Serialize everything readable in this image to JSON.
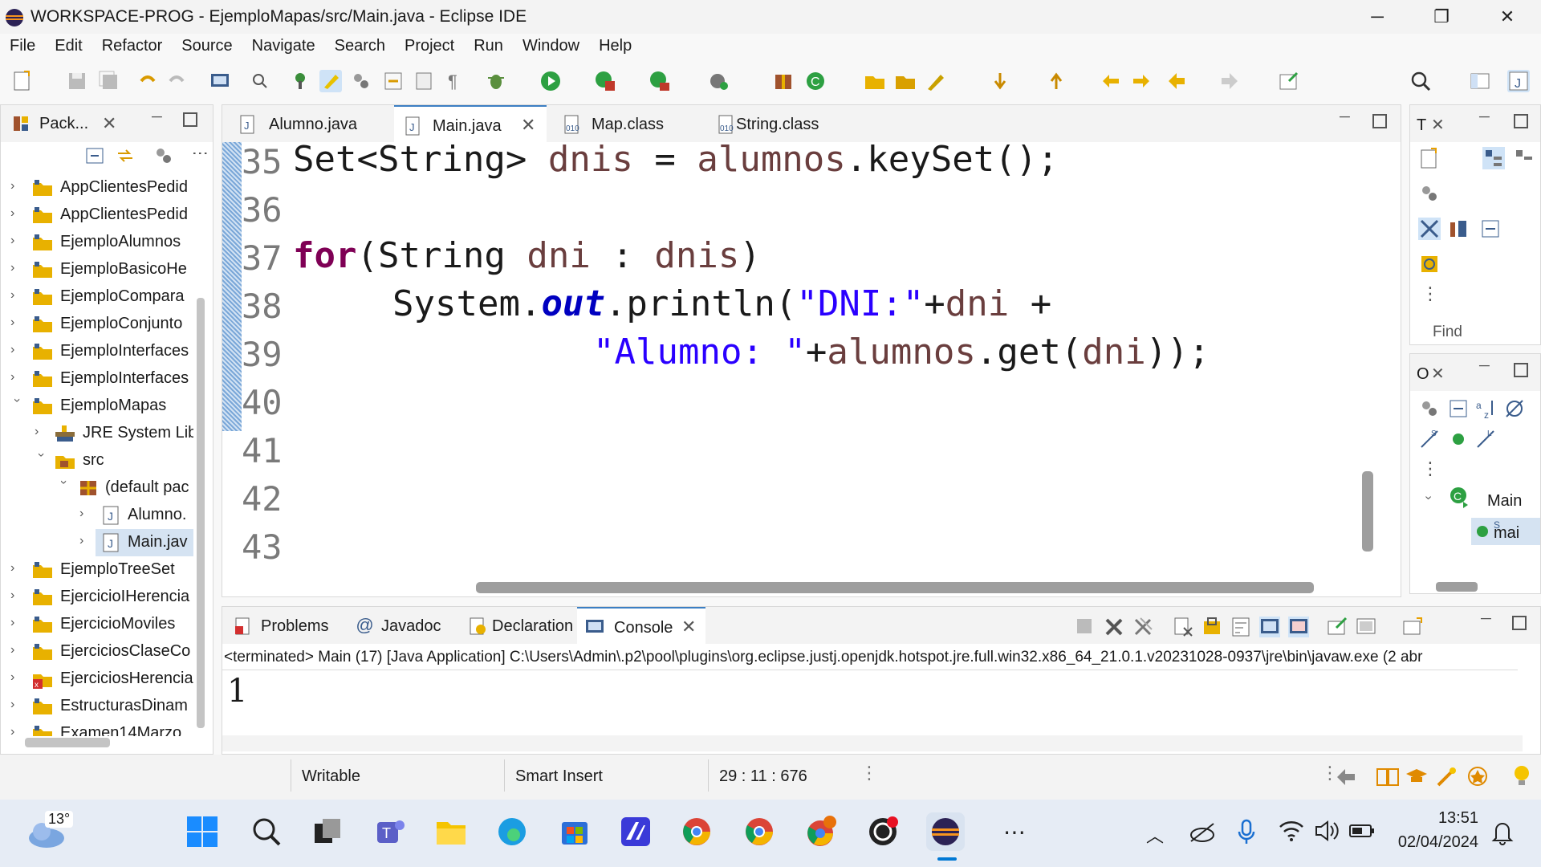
{
  "window": {
    "title": "WORKSPACE-PROG - EjemploMapas/src/Main.java - Eclipse IDE",
    "minimize_icon": "─",
    "restore_icon": "❐",
    "close_icon": "✕"
  },
  "menu": [
    "File",
    "Edit",
    "Refactor",
    "Source",
    "Navigate",
    "Search",
    "Project",
    "Run",
    "Window",
    "Help"
  ],
  "package_explorer": {
    "tab_label": "Pack...",
    "items": [
      {
        "label": "AppClientesPedid",
        "type": "project"
      },
      {
        "label": "AppClientesPedid",
        "type": "project"
      },
      {
        "label": "EjemploAlumnos",
        "type": "project"
      },
      {
        "label": "EjemploBasicoHe",
        "type": "project"
      },
      {
        "label": "EjemploCompara",
        "type": "project"
      },
      {
        "label": "EjemploConjunto",
        "type": "project"
      },
      {
        "label": "EjemploInterfaces",
        "type": "project"
      },
      {
        "label": "EjemploInterfaces",
        "type": "project"
      },
      {
        "label": "EjemploMapas",
        "type": "project-open"
      },
      {
        "label": "JRE System Lib",
        "type": "library"
      },
      {
        "label": "src",
        "type": "source-folder"
      },
      {
        "label": "(default pac",
        "type": "package"
      },
      {
        "label": "Alumno.",
        "type": "java-file"
      },
      {
        "label": "Main.jav",
        "type": "java-file-selected"
      },
      {
        "label": "EjemploTreeSet",
        "type": "project"
      },
      {
        "label": "EjercicioIHerencia",
        "type": "project"
      },
      {
        "label": "EjercicioMoviles",
        "type": "project"
      },
      {
        "label": "EjerciciosClaseCo",
        "type": "project"
      },
      {
        "label": "EjerciciosHerencia",
        "type": "project-error"
      },
      {
        "label": "EstructurasDinam",
        "type": "project"
      },
      {
        "label": "Examen14Marzo",
        "type": "project"
      }
    ]
  },
  "editor": {
    "tabs": [
      {
        "label": "Alumno.java",
        "active": false
      },
      {
        "label": "Main.java",
        "active": true
      },
      {
        "label": "Map.class",
        "active": false
      },
      {
        "label": "String.class",
        "active": false
      }
    ],
    "line_numbers": [
      "35",
      "36",
      "37",
      "38",
      "39",
      "40",
      "41",
      "42",
      "43"
    ],
    "code": {
      "l35_a": "Set<String> ",
      "l35_b": "dnis",
      "l35_c": " = ",
      "l35_d": "alumnos",
      "l35_e": ".keySet();",
      "l37_kw": "for",
      "l37_a": "(String ",
      "l37_b": "dni",
      "l37_c": " : ",
      "l37_d": "dnis",
      "l37_e": ")",
      "l38_a": "System.",
      "l38_out": "out",
      "l38_b": ".println(",
      "l38_str": "\"DNI:\"",
      "l38_c": "+",
      "l38_d": "dni",
      "l38_e": " +",
      "l39_str": "\"Alumno: \"",
      "l39_a": "+",
      "l39_b": "alumnos",
      "l39_c": ".get(",
      "l39_d": "dni",
      "l39_e": "));"
    }
  },
  "right_panels": {
    "top_tab": "T",
    "find_placeholder": "Find",
    "outline_tab": "O",
    "outline_class": "Main",
    "outline_method": "mai"
  },
  "console": {
    "tabs": [
      {
        "label": "Problems",
        "active": false
      },
      {
        "label": "Javadoc",
        "active": false
      },
      {
        "label": "Declaration",
        "active": false
      },
      {
        "label": "Console",
        "active": true
      }
    ],
    "header": "<terminated> Main (17) [Java Application] C:\\Users\\Admin\\.p2\\pool\\plugins\\org.eclipse.justj.openjdk.hotspot.jre.full.win32.x86_64_21.0.1.v20231028-0937\\jre\\bin\\javaw.exe  (2 abr",
    "output": "1"
  },
  "statusbar": {
    "mode": "Writable",
    "insert": "Smart Insert",
    "position": "29 : 11 : 676"
  },
  "taskbar": {
    "weather_temp": "13°",
    "time": "13:51",
    "date": "02/04/2024",
    "colors": {
      "accent": "#0078d4"
    }
  }
}
